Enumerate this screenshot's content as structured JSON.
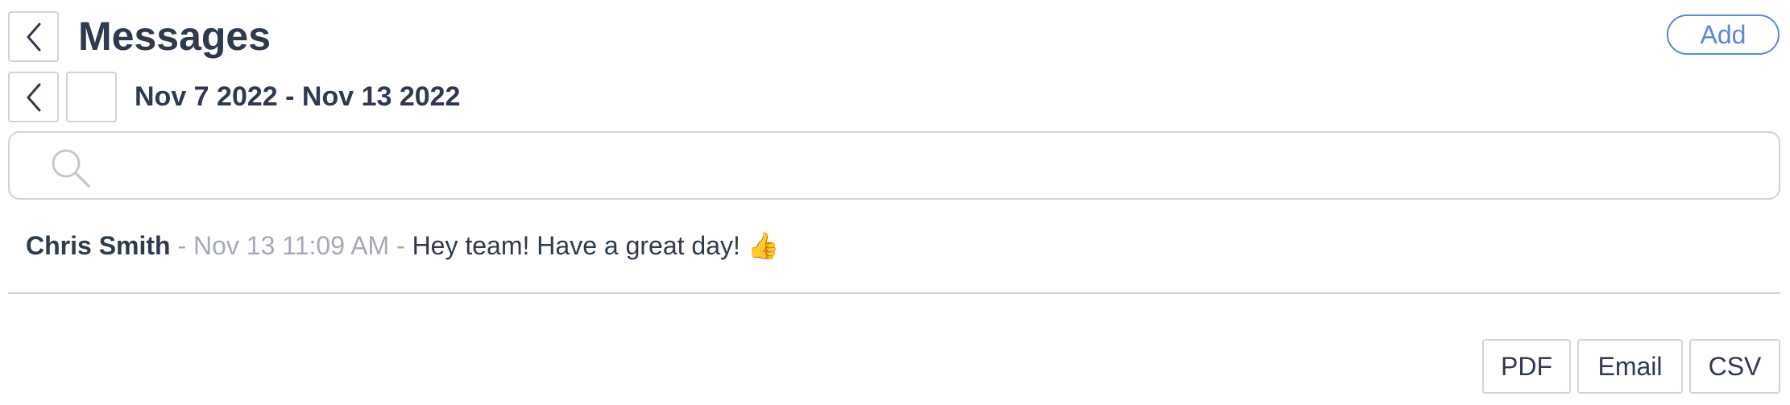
{
  "header": {
    "title": "Messages",
    "add_label": "Add",
    "back_icon": "chevron-left-icon"
  },
  "date_nav": {
    "range": "Nov 7 2022 - Nov 13 2022",
    "prev_icon": "chevron-left-icon"
  },
  "search": {
    "placeholder": "",
    "value": "",
    "icon": "search-icon"
  },
  "messages": [
    {
      "author": "Chris Smith",
      "separator": "-",
      "timestamp": "Nov 13 11:09 AM",
      "text": "Hey team! Have a great day!",
      "emoji": "👍"
    }
  ],
  "export": {
    "pdf_label": "PDF",
    "email_label": "Email",
    "csv_label": "CSV"
  },
  "colors": {
    "accent": "#5b87e0",
    "text": "#2e3a4e",
    "muted": "#a4abb6",
    "border": "#d3d3d3"
  }
}
